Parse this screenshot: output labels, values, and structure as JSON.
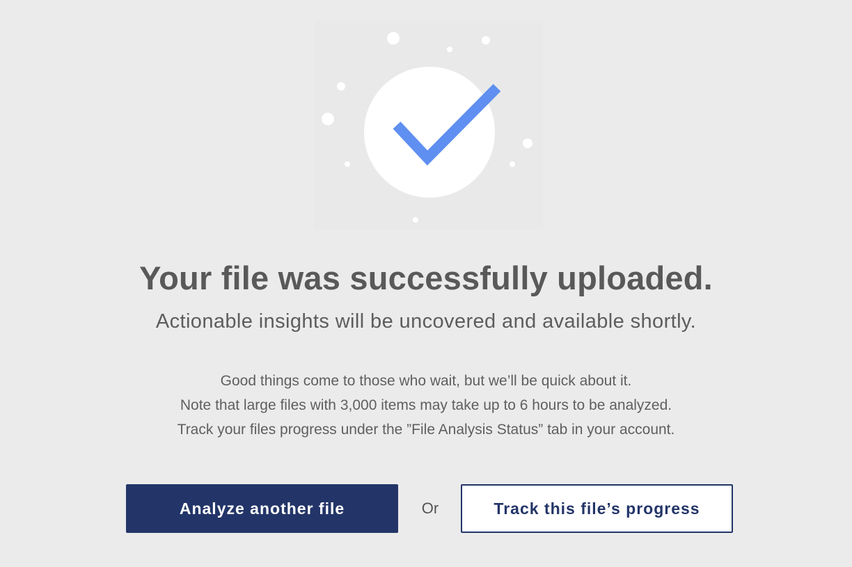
{
  "illustration": {
    "icon": "checkmark-icon",
    "check_color": "#5f8ff0",
    "circle_color": "#ffffff"
  },
  "headline": "Your file was successfully uploaded.",
  "subheadline": "Actionable insights will be uncovered and available shortly.",
  "notes": [
    "Good things come to those who wait, but we’ll be quick about it.",
    "Note that large files with 3,000 items may take up to 6 hours to be analyzed.",
    "Track your files progress under the ”File Analysis Status” tab in your account."
  ],
  "actions": {
    "primary_label": "Analyze another file",
    "separator": "Or",
    "secondary_label": "Track this file’s progress"
  },
  "colors": {
    "primary": "#233568",
    "background": "#ebebeb",
    "text": "#555555"
  }
}
